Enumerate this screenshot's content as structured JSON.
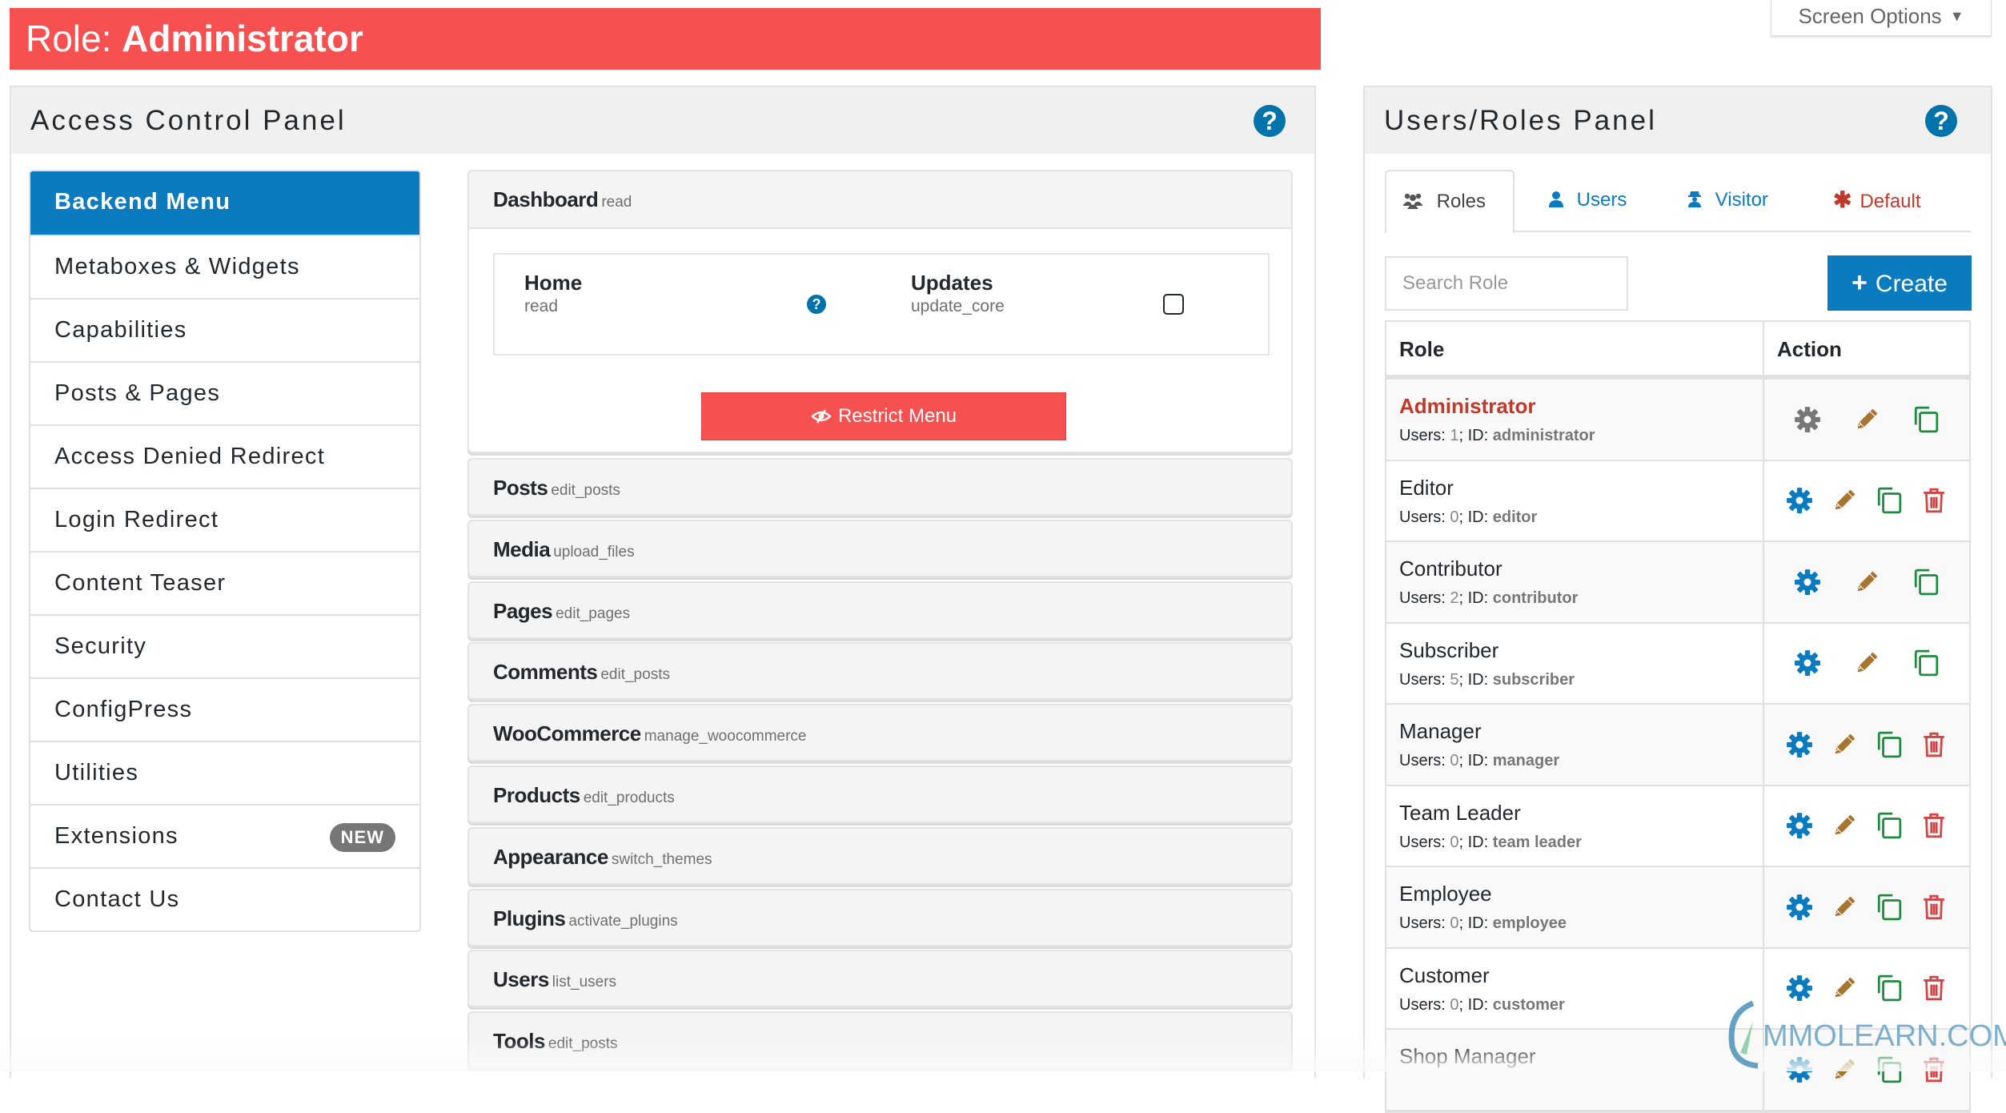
{
  "title_bar": {
    "prefix": "Role:",
    "role": "Administrator"
  },
  "screen_options": {
    "label": "Screen Options"
  },
  "access_panel": {
    "title": "Access Control Panel",
    "sidebar": [
      {
        "label": "Backend Menu",
        "active": true
      },
      {
        "label": "Metaboxes & Widgets"
      },
      {
        "label": "Capabilities"
      },
      {
        "label": "Posts & Pages"
      },
      {
        "label": "Access Denied Redirect"
      },
      {
        "label": "Login Redirect"
      },
      {
        "label": "Content Teaser"
      },
      {
        "label": "Security"
      },
      {
        "label": "ConfigPress"
      },
      {
        "label": "Utilities"
      },
      {
        "label": "Extensions",
        "badge": "NEW"
      },
      {
        "label": "Contact Us"
      }
    ],
    "dashboard": {
      "name": "Dashboard",
      "cap": "read",
      "submenu": [
        {
          "name": "Home",
          "cap": "read",
          "control": "help"
        },
        {
          "name": "Updates",
          "cap": "update_core",
          "control": "checkbox",
          "checked": false
        }
      ],
      "restrict_label": "Restrict Menu"
    },
    "menus": [
      {
        "name": "Posts",
        "cap": "edit_posts"
      },
      {
        "name": "Media",
        "cap": "upload_files"
      },
      {
        "name": "Pages",
        "cap": "edit_pages"
      },
      {
        "name": "Comments",
        "cap": "edit_posts"
      },
      {
        "name": "WooCommerce",
        "cap": "manage_woocommerce"
      },
      {
        "name": "Products",
        "cap": "edit_products"
      },
      {
        "name": "Appearance",
        "cap": "switch_themes"
      },
      {
        "name": "Plugins",
        "cap": "activate_plugins"
      },
      {
        "name": "Users",
        "cap": "list_users"
      },
      {
        "name": "Tools",
        "cap": "edit_posts"
      }
    ]
  },
  "roles_panel": {
    "title": "Users/Roles Panel",
    "tabs": [
      {
        "label": "Roles",
        "icon": "users-group-icon",
        "active": true
      },
      {
        "label": "Users",
        "icon": "user-icon"
      },
      {
        "label": "Visitor",
        "icon": "visitor-spy-icon"
      },
      {
        "label": "Default",
        "icon": "asterisk-icon"
      }
    ],
    "search_placeholder": "Search Role",
    "create_label": "Create",
    "columns": {
      "role": "Role",
      "action": "Action"
    },
    "users_label": "Users:",
    "id_label": "ID:",
    "roles": [
      {
        "name": "Administrator",
        "users": "1",
        "id": "administrator",
        "current": true,
        "deletable": false
      },
      {
        "name": "Editor",
        "users": "0",
        "id": "editor",
        "deletable": true
      },
      {
        "name": "Contributor",
        "users": "2",
        "id": "contributor",
        "deletable": false
      },
      {
        "name": "Subscriber",
        "users": "5",
        "id": "subscriber",
        "deletable": false
      },
      {
        "name": "Manager",
        "users": "0",
        "id": "manager",
        "deletable": true
      },
      {
        "name": "Team Leader",
        "users": "0",
        "id": "team leader",
        "deletable": true
      },
      {
        "name": "Employee",
        "users": "0",
        "id": "employee",
        "deletable": true
      },
      {
        "name": "Customer",
        "users": "0",
        "id": "customer",
        "deletable": true
      },
      {
        "name": "Shop Manager",
        "users": "",
        "id": "",
        "deletable": true
      }
    ]
  },
  "watermark": {
    "text": "MMOLEARN.COM"
  },
  "colors": {
    "accent_blue": "#0a7bbf",
    "danger_red": "#f75050",
    "admin_red": "#c0392b",
    "edit_brown": "#a8742e",
    "clone_green": "#1e8a3f",
    "delete_red": "#d04545"
  }
}
